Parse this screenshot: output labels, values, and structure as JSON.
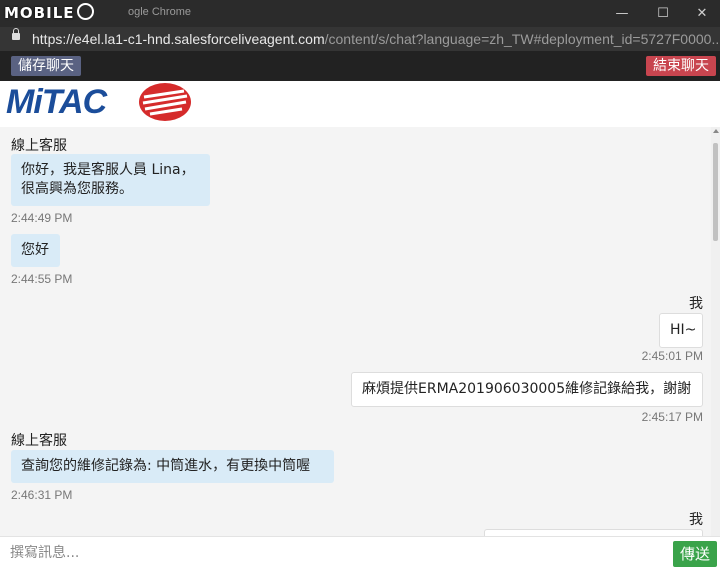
{
  "window": {
    "brand": "MOBILE",
    "title": "ogle Chrome",
    "minimize": "—",
    "maximize": "☐",
    "close": "✕"
  },
  "address": {
    "url_main": "https://e4el.la1-c1-hnd.salesforceliveagent.com",
    "url_rest": "/content/s/chat?language=zh_TW#deployment_id=5727F0000..."
  },
  "toolbar": {
    "save_label": "儲存聊天",
    "end_label": "結束聊天",
    "save_color": "#5a6282",
    "end_color": "#c8454f"
  },
  "header": {
    "logo_text": "MiTAC",
    "logo_color": "#1b4d9a",
    "emblem_color": "#d52b2b"
  },
  "messages": [
    {
      "role": "agent",
      "sender": "線上客服",
      "lines": [
        "你好，我是客服人員 Lina，",
        "很高興為您服務。"
      ],
      "time": "2:44:49 PM"
    },
    {
      "role": "agent",
      "sender": "",
      "lines": [
        "您好"
      ],
      "time": "2:44:55 PM"
    },
    {
      "role": "user",
      "sender": "我",
      "lines": [
        "HI~"
      ],
      "time": "2:45:01 PM"
    },
    {
      "role": "user",
      "sender": "",
      "lines": [
        "麻煩提供ERMA201906030005維修記錄給我，謝謝"
      ],
      "time": "2:45:17 PM"
    },
    {
      "role": "agent",
      "sender": "線上客服",
      "lines": [
        "查詢您的維修記錄為: 中筒進水，有更換中筒喔"
      ],
      "time": "2:46:31 PM"
    },
    {
      "role": "user",
      "sender": "我",
      "lines": [],
      "time": ""
    }
  ],
  "composer": {
    "placeholder": "撰寫訊息...",
    "send_label": "傳送",
    "send_color": "#3aa34a"
  }
}
